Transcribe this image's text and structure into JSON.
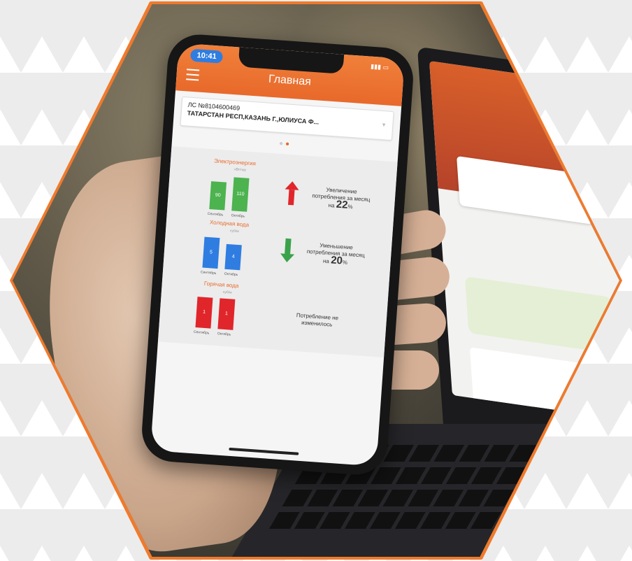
{
  "status_bar": {
    "time": "10:41"
  },
  "app": {
    "title": "Главная"
  },
  "account": {
    "number": "ЛС №8104600469",
    "address": "ТАТАРСТАН РЕСП,КАЗАНЬ Г.,ЮЛИУСА Ф..."
  },
  "stats": {
    "electricity": {
      "title": "Электроэнергия",
      "unit": "кВт/час",
      "bars": [
        {
          "label": "Сентябрь",
          "value": "90"
        },
        {
          "label": "Октябрь",
          "value": "110"
        }
      ],
      "message_line1": "Увеличение",
      "message_line2": "потребления за месяц",
      "message_prefix": "на",
      "message_value": "22",
      "message_suffix": "%"
    },
    "cold_water": {
      "title": "Холодная вода",
      "unit": "куб/м",
      "bars": [
        {
          "label": "Сентябрь",
          "value": "5"
        },
        {
          "label": "Октябрь",
          "value": "4"
        }
      ],
      "message_line1": "Уменьшение",
      "message_line2": "потребления за месяц",
      "message_prefix": "на",
      "message_value": "20",
      "message_suffix": "%"
    },
    "hot_water": {
      "title": "Горячая вода",
      "unit": "куб/м",
      "bars": [
        {
          "label": "Сентябрь",
          "value": "1"
        },
        {
          "label": "Октябрь",
          "value": "1"
        }
      ],
      "message_line1": "Потребление не",
      "message_line2": "изменилось"
    }
  },
  "colors": {
    "brand_orange": "#e8692b",
    "electricity": "#4cb34f",
    "cold_water": "#2f7de1",
    "hot_water": "#e0262b"
  }
}
